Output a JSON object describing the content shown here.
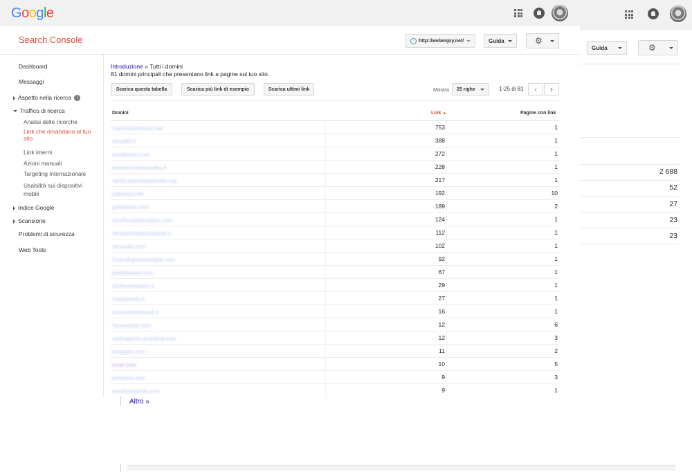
{
  "google_bar": {
    "logo": [
      "G",
      "o",
      "o",
      "g",
      "l",
      "e"
    ]
  },
  "header": {
    "title": "Search Console",
    "site_selector": "http://webenjoy.net/",
    "help_label": "Guida"
  },
  "sidebar": {
    "dashboard": "Dashboard",
    "messages": "Messaggi",
    "search_appearance": "Aspetto nella ricerca",
    "search_traffic": "Traffico di ricerca",
    "search_traffic_items": [
      "Analisi delle ricerche",
      "Link che rimandano al tuo",
      "sito",
      "Link interni",
      "Azioni manuali",
      "Targeting internazionale",
      "Usabilità sui dispositivi",
      "mobili"
    ],
    "google_index": "Indice Google",
    "crawl": "Scansione",
    "security": "Problemi di sicurezza",
    "web_tools": "Web Tools"
  },
  "breadcrumb": {
    "link": "Introduzione",
    "separator": " » ",
    "current": "Tutti i domini"
  },
  "summary": "81 domini principali che presentano link a pagine sul tuo sito.",
  "actions": {
    "download_table": "Scarica questa tabella",
    "download_samples": "Scarica più link di esempio",
    "download_latest": "Scarica ultimi link"
  },
  "pagination": {
    "show_label": "Mostra",
    "rows_label": "25 righe",
    "range": "1-25 di 81"
  },
  "table": {
    "headers": {
      "domain": "Domini",
      "links": "Link",
      "pages": "Pagine con link"
    },
    "rows": [
      {
        "domain": "madmitalfanscaz.net",
        "links": "753",
        "pages": "1"
      },
      {
        "domain": "almsdkt.it",
        "links": "388",
        "pages": "1"
      },
      {
        "domain": "wordpress.com",
        "links": "272",
        "pages": "1"
      },
      {
        "domain": "dataknschalacasdks.it",
        "links": "228",
        "pages": "1"
      },
      {
        "domain": "ramficaalsnalgalshnas.org",
        "links": "217",
        "pages": "1"
      },
      {
        "domain": "daksolvy.info",
        "links": "192",
        "pages": "10"
      },
      {
        "domain": "globdlmes.com",
        "links": "189",
        "pages": "2"
      },
      {
        "domain": "randficreasdonalers.com",
        "links": "124",
        "pages": "1"
      },
      {
        "domain": "alnsadsmlaedcinkasdt.it",
        "links": "112",
        "pages": "1"
      },
      {
        "domain": "almssdts.com",
        "links": "102",
        "pages": "1"
      },
      {
        "domain": "hasmdhgsemlnafgiet.com",
        "links": "92",
        "pages": "1"
      },
      {
        "domain": "jdmfdsaasd.com",
        "links": "67",
        "pages": "1"
      },
      {
        "domain": "dsufnsdmdasm.it",
        "links": "29",
        "pages": "1"
      },
      {
        "domain": "mssdamelo.it",
        "links": "27",
        "pages": "1"
      },
      {
        "domain": "mosmsmldenasd.it",
        "links": "16",
        "pages": "1"
      },
      {
        "domain": "fasuasdnal.com",
        "links": "12",
        "pages": "6"
      },
      {
        "domain": "sadsagenm.acasiimd.com",
        "links": "12",
        "pages": "3"
      },
      {
        "domain": "blogspot.com",
        "links": "11",
        "pages": "2"
      },
      {
        "domain": "tusar.com",
        "links": "10",
        "pages": "5"
      },
      {
        "domain": "pinterest.com",
        "links": "9",
        "pages": "3"
      },
      {
        "domain": "asadfsamlenla.com",
        "links": "9",
        "pages": "1"
      }
    ]
  },
  "more_link": "Altro »",
  "ghost_panel": {
    "help_label": "Guida",
    "values": [
      "2 688",
      "52",
      "27",
      "23",
      "23"
    ]
  },
  "colors": {
    "accent_red": "#dd4b39",
    "link_blue": "#1a0dab"
  }
}
